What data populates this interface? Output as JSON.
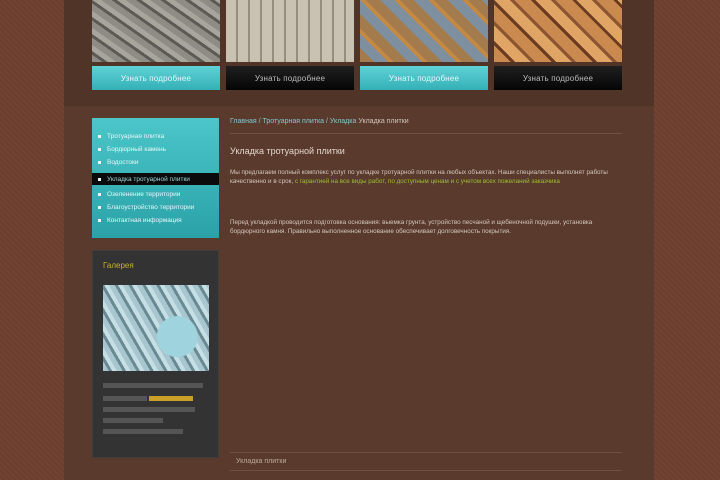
{
  "thumbnails": [
    {
      "button_label": "Узнать подробнее",
      "style": "teal"
    },
    {
      "button_label": "Узнать подробнее",
      "style": "dark"
    },
    {
      "button_label": "Узнать подробнее",
      "style": "teal"
    },
    {
      "button_label": "Узнать подробнее",
      "style": "dark"
    }
  ],
  "sidebar": {
    "menu": [
      {
        "label": "Тротуарная плитка"
      },
      {
        "label": "Бордюрный камень"
      },
      {
        "label": "Водостоки"
      },
      {
        "label": "Укладка тротуарной плитки"
      },
      {
        "label": "Озеленение территории"
      },
      {
        "label": "Благоустройство территории"
      },
      {
        "label": "Контактная информация"
      }
    ],
    "promo": {
      "title": "Галерея"
    }
  },
  "content": {
    "breadcrumb": {
      "link": "Главная / Тротуарная плитка / Укладка",
      "current": "Укладка плитки"
    },
    "heading": "Укладка тротуарной плитки",
    "para1_start": "Мы предлагаем полный комплекс услуг по укладке тротуарной плитки на любых объектах. Наши специалисты выполнят работы качественно и в срок, ",
    "para1_link": "с гарантией на все виды работ, по доступным ценам и с учетом всех пожеланий заказчика",
    "para2": "Перед укладкой проводится подготовка основания: выемка грунта, устройство песчаной и щебеночной подушки, установка бордюрного камня. Правильно выполненное основание обеспечивает долговечность покрытия.",
    "footer": "Укладка плитки"
  },
  "colors": {
    "accent": "#3bbac0",
    "link_green": "#9bbf33",
    "background": "#6e3f2f"
  }
}
